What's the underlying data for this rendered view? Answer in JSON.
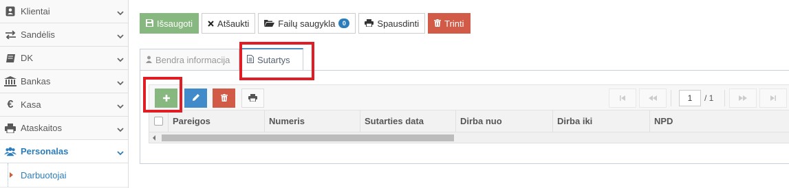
{
  "sidebar": {
    "items": [
      {
        "label": "Klientai",
        "icon": "user-card-icon"
      },
      {
        "label": "Sandėlis",
        "icon": "exchange-arrows-icon"
      },
      {
        "label": "DK",
        "icon": "book-icon"
      },
      {
        "label": "Bankas",
        "icon": "bank-icon"
      },
      {
        "label": "Kasa",
        "icon": "euro-icon"
      },
      {
        "label": "Ataskaitos",
        "icon": "printer-icon"
      },
      {
        "label": "Personalas",
        "icon": "users-icon"
      }
    ],
    "sub_item": {
      "label": "Darbuotojai"
    }
  },
  "toolbar": {
    "save_label": "Išsaugoti",
    "cancel_label": "Atšaukti",
    "files_label": "Failų saugykla",
    "files_count": "0",
    "print_label": "Spausdinti",
    "delete_label": "Trinti"
  },
  "tabs": [
    {
      "label": "Bendra informacija",
      "active": false
    },
    {
      "label": "Sutartys",
      "active": true
    }
  ],
  "grid": {
    "pager": {
      "page": "1",
      "total": "/ 1"
    },
    "columns": [
      "Pareigos",
      "Numeris",
      "Sutarties data",
      "Dirba nuo",
      "Dirba iki",
      "NPD"
    ]
  },
  "colors": {
    "accent": "#2b7dbc",
    "success": "#87b87f",
    "danger": "#d15b47",
    "highlight": "#e01c24"
  }
}
